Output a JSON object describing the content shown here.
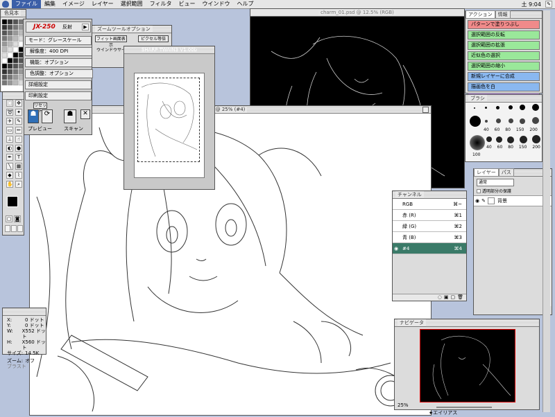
{
  "menubar": {
    "items": [
      "ファイル",
      "編集",
      "イメージ",
      "レイヤー",
      "選択範囲",
      "フィルタ",
      "ビュー",
      "ウインドウ",
      "ヘルプ"
    ],
    "active_index": 0,
    "clock": "土 9:04"
  },
  "colors": {
    "accent": "#3b5fa8",
    "channel_selected": "#3a7a68"
  },
  "swatches_panel": {
    "title": "色見本"
  },
  "scanner_dialog": {
    "model": "JX-250",
    "reflect": "反射",
    "mode": "モード：グレースケール",
    "resolution": "解像度：400 DPI",
    "func_option": "機能：オプション",
    "color_option": "色調整：オプション",
    "detail": "詳細設定",
    "print": "印刷設定",
    "reset": "リセット",
    "preview": "プレビュー",
    "scan": "スキャン"
  },
  "zoom_options": {
    "title": "ズームツールオプション",
    "fit": "フィット画面表示",
    "pixel": "ピクセル等倍",
    "resize": "ウインドウサイズを変更"
  },
  "twain": {
    "title": "SHARP TWAIN3 V1.00b"
  },
  "doc_sketch": {
    "title": "@ 25% (#4)"
  },
  "doc_dark": {
    "title": "charm_01.psd @ 12.5% (RGB)"
  },
  "actions": {
    "tabs": [
      "アクション",
      "情報"
    ],
    "items": [
      {
        "label": "パターンで塗りつぶし",
        "color": "#f08a8a"
      },
      {
        "label": "選択範囲の反転",
        "color": "#9ae89a"
      },
      {
        "label": "選択範囲の拡張",
        "color": "#9ae89a"
      },
      {
        "label": "近似色の選択",
        "color": "#9ae89a"
      },
      {
        "label": "選択範囲の縮小",
        "color": "#9ae89a"
      },
      {
        "label": "新規レイヤーに合成",
        "color": "#8ab8f0"
      },
      {
        "label": "描画色を白",
        "color": "#8ab8f0"
      },
      {
        "label": "bmpで保存",
        "color": "#c89af0"
      }
    ]
  },
  "brushes": {
    "title": "ブラシ",
    "labels": [
      "40",
      "60",
      "80",
      "150",
      "200",
      "100"
    ]
  },
  "layers": {
    "tabs": [
      "レイヤー",
      "パス"
    ],
    "mode": "通常",
    "preserve": "透明部分の保護",
    "layer_name": "背景"
  },
  "channels": {
    "title": "チャンネル",
    "rows": [
      {
        "name": "RGB",
        "shortcut": "⌘~"
      },
      {
        "name": "赤 (R)",
        "shortcut": "⌘1"
      },
      {
        "name": "緑 (G)",
        "shortcut": "⌘2"
      },
      {
        "name": "青 (B)",
        "shortcut": "⌘3"
      },
      {
        "name": "#4",
        "shortcut": "⌘4"
      }
    ]
  },
  "info": {
    "rows": [
      {
        "k": "X:",
        "v": "0 ドット"
      },
      {
        "k": "Y:",
        "v": "0 ドット"
      },
      {
        "k": "W:",
        "v": "X552 ドット"
      },
      {
        "k": "H:",
        "v": "X560 ドット"
      },
      {
        "k": "サイズ:",
        "v": "14 5K"
      }
    ],
    "zoom_label": "ズーム:",
    "zoom_value": "オフ",
    "extra": "ブラスト"
  },
  "navigator": {
    "title": "ナビゲータ",
    "zoom": "25%"
  },
  "taskbar": {
    "label": "エイリアス"
  }
}
